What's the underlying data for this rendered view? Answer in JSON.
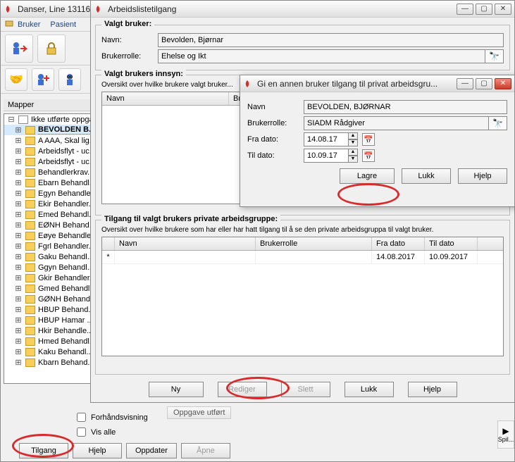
{
  "main": {
    "title": "Danser, Line 13116...",
    "menu": {
      "bruker": "Bruker",
      "pasient": "Pasient"
    },
    "mapper_label": "Mapper",
    "tree": {
      "root": "Ikke utførte oppga...",
      "items": [
        "BEVOLDEN B...",
        "A AAA, Skal lig...",
        "Arbeidsflyt - uc...",
        "Arbeidsflyt - uc...",
        "Behandlerkrav...",
        "Ebarn Behandl...",
        "Egyn Behandle...",
        "Ekir Behandler...",
        "Emed Behandl...",
        "EØNH Behand...",
        "Eøye Behandle...",
        "Fgrl Behandler...",
        "Gaku Behandl...",
        "Ggyn Behandl...",
        "Gkir Behandler...",
        "Gmed Behandl...",
        "GØNH Behand...",
        "HBUP Behand...",
        "HBUP Hamar ...",
        "Hkir Behandle...",
        "Hmed Behandl...",
        "Kaku Behandl...",
        "Kbarn Behand..."
      ]
    },
    "forhandsvisning": "Forhåndsvisning",
    "vis_alle": "Vis alle",
    "tilgang": "Tilgang",
    "hjelp": "Hjelp",
    "oppdater": "Oppdater",
    "apne": "Åpne",
    "oppgave_utfort": "Oppgave utført",
    "spil": "Spil..."
  },
  "arbeid": {
    "title": "Arbeidslistetilgang",
    "valgt_bruker": {
      "legend": "Valgt bruker:",
      "navn_label": "Navn:",
      "navn_value": "Bevolden, Bjørnar",
      "rolle_label": "Brukerrolle:",
      "rolle_value": "Ehelse og Ikt"
    },
    "innsyn": {
      "legend": "Valgt brukers innsyn:",
      "overskrift": "Oversikt over hvilke brukere valgt bruker...",
      "col_navn": "Navn",
      "col_bru": "Bru..."
    },
    "privat": {
      "legend": "Tilgang til valgt brukers private arbeidsgruppe:",
      "overskrift": "Oversikt over hvilke brukere som har eller har hatt tilgang til å se den private arbeidsgruppa til valgt bruker.",
      "col_navn": "Navn",
      "col_rolle": "Brukerrolle",
      "col_fra": "Fra dato",
      "col_til": "Til dato",
      "row": {
        "fra": "14.08.2017",
        "til": "10.09.2017"
      }
    },
    "buttons": {
      "ny": "Ny",
      "rediger": "Rediger",
      "slett": "Slett",
      "lukk": "Lukk",
      "hjelp": "Hjelp"
    }
  },
  "modal": {
    "title": "Gi en annen bruker tilgang til privat arbeidsgru...",
    "navn_label": "Navn",
    "navn_value": "BEVOLDEN, BJØRNAR",
    "rolle_label": "Brukerrolle:",
    "rolle_value": "SIADM Rådgiver",
    "fra_label": "Fra dato:",
    "fra_value": "14.08.17",
    "til_label": "Til dato:",
    "til_value": "10.09.17",
    "lagre": "Lagre",
    "lukk": "Lukk",
    "hjelp": "Hjelp"
  }
}
